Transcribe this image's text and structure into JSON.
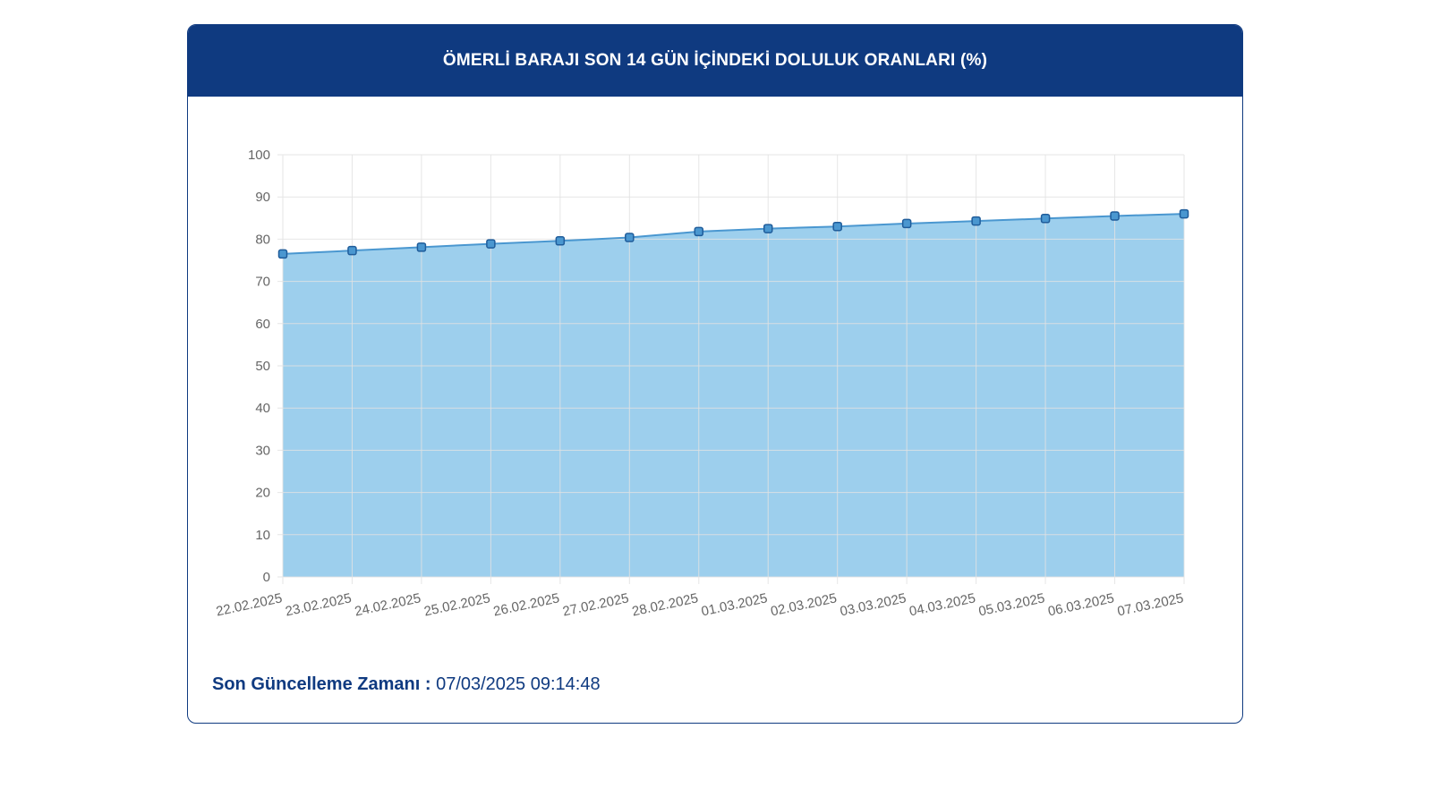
{
  "panel": {
    "title": "ÖMERLİ BARAJI SON 14 GÜN İÇİNDEKİ DOLULUK ORANLARI (%)",
    "footer_label": "Son Güncelleme Zamanı :",
    "footer_value": "07/03/2025 09:14:48"
  },
  "colors": {
    "header_bg": "#0f3a80",
    "area_fill": "#9dcfed",
    "line": "#4a97d0",
    "marker_fill": "#4a97d0",
    "marker_stroke": "#1f5c9a",
    "grid": "#e2e2e2"
  },
  "chart_data": {
    "type": "area",
    "title": "ÖMERLİ BARAJI SON 14 GÜN İÇİNDEKİ DOLULUK ORANLARI (%)",
    "xlabel": "",
    "ylabel": "",
    "ylim": [
      0,
      100
    ],
    "yticks": [
      0,
      10,
      20,
      30,
      40,
      50,
      60,
      70,
      80,
      90,
      100
    ],
    "grid": true,
    "categories": [
      "22.02.2025",
      "23.02.2025",
      "24.02.2025",
      "25.02.2025",
      "26.02.2025",
      "27.02.2025",
      "28.02.2025",
      "01.03.2025",
      "02.03.2025",
      "03.03.2025",
      "04.03.2025",
      "05.03.2025",
      "06.03.2025",
      "07.03.2025"
    ],
    "values": [
      76.5,
      77.3,
      78.1,
      78.9,
      79.6,
      80.4,
      81.8,
      82.5,
      83.0,
      83.7,
      84.3,
      84.9,
      85.5,
      86.0
    ]
  }
}
